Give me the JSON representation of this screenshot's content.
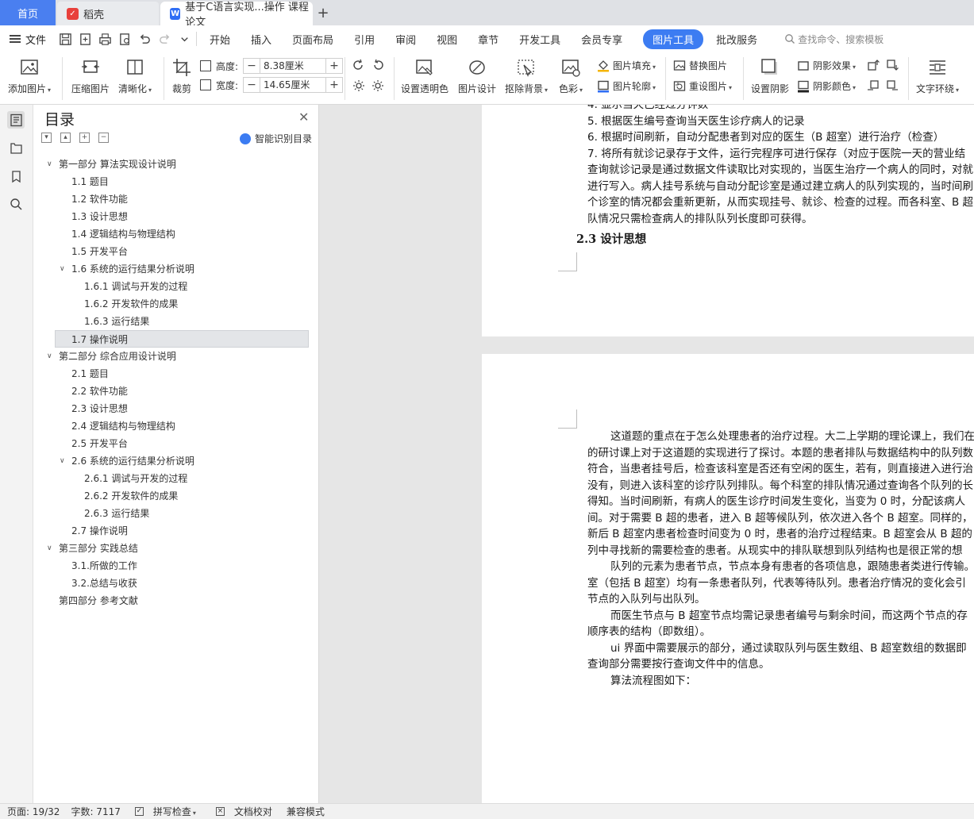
{
  "tabs": {
    "home": "首页",
    "daoke": "稻壳",
    "doc": "基于C语言实现...操作 课程论文",
    "add_icon": "plus-icon"
  },
  "menu": {
    "file": "文件",
    "tabs": [
      "开始",
      "插入",
      "页面布局",
      "引用",
      "审阅",
      "视图",
      "章节",
      "开发工具",
      "会员专享",
      "图片工具",
      "批改服务"
    ],
    "active_tab": "图片工具",
    "search_placeholder": "查找命令、搜索模板",
    "accent": "#3c7cf2"
  },
  "ribbon": {
    "add_picture": "添加图片",
    "compress": "压缩图片",
    "sharpen": "清晰化",
    "crop": "裁剪",
    "height_label": "高度:",
    "height_value": "8.38厘米",
    "width_label": "宽度:",
    "width_value": "14.65厘米",
    "set_transparent": "设置透明色",
    "picture_design": "图片设计",
    "remove_bg": "抠除背景",
    "color": "色彩",
    "fill": "图片填充",
    "outline": "图片轮廓",
    "replace": "替换图片",
    "reset": "重设图片",
    "set_shadow": "设置阴影",
    "shadow_effect": "阴影效果",
    "shadow_color": "阴影颜色",
    "text_wrap": "文字环绕"
  },
  "toc": {
    "title": "目录",
    "smart": "智能识别目录",
    "items": [
      {
        "label": "第一部分  算法实现设计说明",
        "level": 1,
        "arrow": "open"
      },
      {
        "label": "1.1 题目",
        "level": 2
      },
      {
        "label": "1.2 软件功能",
        "level": 2
      },
      {
        "label": "1.3 设计思想",
        "level": 2
      },
      {
        "label": "1.4 逻辑结构与物理结构",
        "level": 2
      },
      {
        "label": "1.5 开发平台",
        "level": 2
      },
      {
        "label": "1.6 系统的运行结果分析说明",
        "level": 2,
        "arrow": "open"
      },
      {
        "label": "1.6.1  调试与开发的过程",
        "level": 3
      },
      {
        "label": "1.6.2  开发软件的成果",
        "level": 3
      },
      {
        "label": "1.6.3  运行结果",
        "level": 3
      },
      {
        "label": "1.7 操作说明",
        "level": 2,
        "selected": true
      },
      {
        "label": "第二部分  综合应用设计说明",
        "level": 1,
        "arrow": "open"
      },
      {
        "label": "2.1 题目",
        "level": 2
      },
      {
        "label": "2.2 软件功能",
        "level": 2
      },
      {
        "label": "2.3 设计思想",
        "level": 2
      },
      {
        "label": "2.4 逻辑结构与物理结构",
        "level": 2
      },
      {
        "label": "2.5 开发平台",
        "level": 2
      },
      {
        "label": "2.6 系统的运行结果分析说明",
        "level": 2,
        "arrow": "open"
      },
      {
        "label": "2.6.1  调试与开发的过程",
        "level": 3
      },
      {
        "label": "2.6.2  开发软件的成果",
        "level": 3
      },
      {
        "label": "2.6.3  运行结果",
        "level": 3
      },
      {
        "label": "2.7 操作说明",
        "level": 2
      },
      {
        "label": "第三部分  实践总结",
        "level": 1,
        "arrow": "open"
      },
      {
        "label": "3.1.所做的工作",
        "level": 2
      },
      {
        "label": "3.2.总结与收获",
        "level": 2
      },
      {
        "label": "第四部分  参考文献",
        "level": 1
      }
    ]
  },
  "document": {
    "page1_lines": [
      "4.  显示当天已经过分钟数",
      "5.  根据医生编号查询当天医生诊疗病人的记录",
      "6.  根据时间刷新，自动分配患者到对应的医生（B 超室）进行治疗（检查）",
      "7.  将所有就诊记录存于文件，运行完程序可进行保存（对应于医院一天的营业结",
      "查询就诊记录是通过数据文件读取比对实现的，当医生治疗一个病人的同时，对就",
      "进行写入。病人挂号系统与自动分配诊室是通过建立病人的队列实现的，当时间刷",
      "个诊室的情况都会重新更新，从而实现挂号、就诊、检查的过程。而各科室、B 超",
      "队情况只需检查病人的排队队列长度即可获得。"
    ],
    "page1_heading": "2.3 设计思想",
    "page2_lines": [
      {
        "t": "这道题的重点在于怎么处理患者的治疗过程。大二上学期的理论课上，我们在",
        "indent": true
      },
      {
        "t": "的研讨课上对于这道题的实现进行了探讨。本题的患者排队与数据结构中的队列数",
        "indent": false
      },
      {
        "t": "符合，当患者挂号后，检查该科室是否还有空闲的医生，若有，则直接进入进行治",
        "indent": false
      },
      {
        "t": "没有，则进入该科室的诊疗队列排队。每个科室的排队情况通过查询各个队列的长",
        "indent": false
      },
      {
        "t": "得知。当时间刷新，有病人的医生诊疗时间发生变化，当变为 0 时，分配该病人",
        "indent": false
      },
      {
        "t": "间。对于需要 B 超的患者，进入 B 超等候队列，依次进入各个 B 超室。同样的，",
        "indent": false
      },
      {
        "t": "新后 B 超室内患者检查时间变为 0 时，患者的治疗过程结束。B 超室会从 B 超的",
        "indent": false
      },
      {
        "t": "列中寻找新的需要检查的患者。从现实中的排队联想到队列结构也是很正常的想",
        "indent": false
      },
      {
        "t": "队列的元素为患者节点，节点本身有患者的各项信息，跟随患者类进行传输。",
        "indent": true
      },
      {
        "t": "室（包括 B 超室）均有一条患者队列，代表等待队列。患者治疗情况的变化会引",
        "indent": false
      },
      {
        "t": "节点的入队列与出队列。",
        "indent": false
      },
      {
        "t": "而医生节点与 B 超室节点均需记录患者编号与剩余时间，而这两个节点的存",
        "indent": true
      },
      {
        "t": "顺序表的结构（即数组）。",
        "indent": false
      },
      {
        "t": "ui 界面中需要展示的部分，通过读取队列与医生数组、B 超室数组的数据即",
        "indent": true
      },
      {
        "t": "查询部分需要按行查询文件中的信息。",
        "indent": false
      },
      {
        "t": "算法流程图如下：",
        "indent": true
      }
    ]
  },
  "status": {
    "page": "页面: 19/32",
    "words": "字数: 7117",
    "spell": "拼写检查",
    "proof": "文档校对",
    "compat": "兼容模式"
  }
}
